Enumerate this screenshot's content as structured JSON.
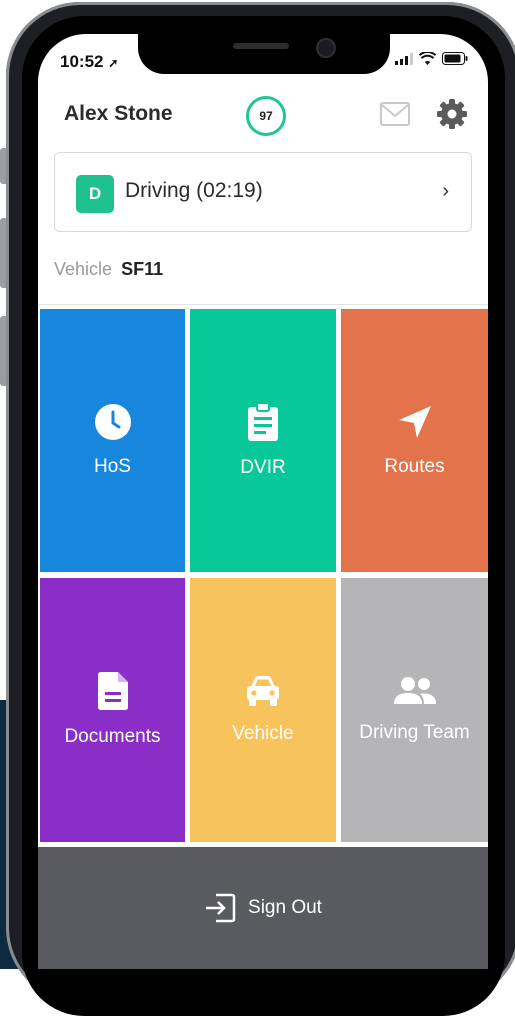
{
  "status_bar": {
    "time": "10:52"
  },
  "header": {
    "driver_name": "Alex Stone",
    "score": "97"
  },
  "status_card": {
    "badge": "D",
    "text": "Driving (02:19)",
    "chevron": "›"
  },
  "vehicle": {
    "label": "Vehicle",
    "value": "SF11"
  },
  "tiles": [
    {
      "label": "HoS",
      "icon": "clock-icon",
      "color": "#1787dd"
    },
    {
      "label": "DVIR",
      "icon": "clipboard-icon",
      "color": "#08c89a"
    },
    {
      "label": "Routes",
      "icon": "navigation-arrow-icon",
      "color": "#e2734a"
    },
    {
      "label": "Documents",
      "icon": "document-icon",
      "color": "#8a2ec7"
    },
    {
      "label": "Vehicle",
      "icon": "car-icon",
      "color": "#f6c35c"
    },
    {
      "label": "Driving Team",
      "icon": "team-icon",
      "color": "#b5b5b8"
    }
  ],
  "sign_out": {
    "label": "Sign Out",
    "icon": "sign-out-icon"
  },
  "colors": {
    "accent_green": "#1fc18e",
    "sign_out_bg": "#5a5b5e"
  }
}
